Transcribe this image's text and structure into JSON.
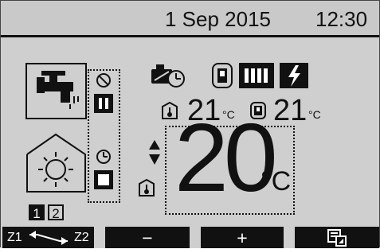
{
  "header": {
    "date": "1 Sep 2015",
    "time": "12:30"
  },
  "temps": {
    "room_temp": "21",
    "room_unit": "°C",
    "tank_temp": "21",
    "tank_unit": "°C",
    "target_temp": "20",
    "target_unit": "°C"
  },
  "zones": [
    "1",
    "2"
  ],
  "footer": {
    "zone_from": "Z1",
    "zone_to": "Z2",
    "minus_label": "−",
    "plus_label": "+"
  },
  "icons": {
    "hot_water": "tap-icon",
    "heating": "house-sun-icon",
    "prohibit": "prohibit-icon",
    "pause": "pause-icon",
    "timer": "clock-icon",
    "stop": "stop-icon",
    "heat_pump": "heat-pump-timer-icon",
    "tank": "tank-icon",
    "booster": "booster-heater-icon",
    "immersion": "immersion-heater-icon",
    "room_thermo": "thermometer-icon",
    "updown": "up-down-arrow-icon",
    "menu": "menu-icon"
  },
  "colors": {
    "screen": "#cfcfcf",
    "ink": "#111111"
  }
}
